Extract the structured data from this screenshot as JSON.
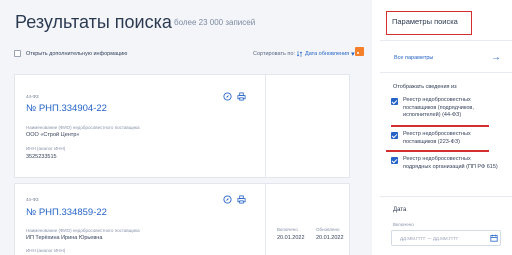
{
  "header": {
    "title": "Результаты поиска",
    "count": "более 23 000 записей"
  },
  "toolbar": {
    "more_info_label": "Открыть дополнительную информацию",
    "sort_label": "Сортировать по:",
    "sort_value": "Дата обновления"
  },
  "results": [
    {
      "law": "44-ФЗ",
      "number": "№ РНП.334904-22",
      "supplier_label": "Наименование (ФИО) недобросовестного поставщика",
      "supplier": "ООО «Строй Центр»",
      "inn_label": "ИНН (аналог ИНН)",
      "inn": "3525233515"
    },
    {
      "law": "44-ФЗ",
      "number": "№ РНП.334859-22",
      "supplier_label": "Наименование (ФИО) недобросовестного поставщика",
      "supplier": "ИП Терёхина Ирина Юрьевна",
      "inn_label": "ИНН (аналог ИНН)",
      "included_label": "Включено",
      "included_date": "20.01.2022",
      "updated_label": "Обновлено",
      "updated_date": "20.01.2022"
    }
  ],
  "panel": {
    "title": "Параметры поиска",
    "all_params": "Все параметры",
    "show_label": "Отображать сведения из",
    "registries": [
      {
        "text": "Реестр недобросовестных поставщиков (подрядчиков, исполнителей) (44-ФЗ)",
        "checked": true
      },
      {
        "text": "Реестр недобросовестных поставщиков (223-ФЗ)",
        "checked": true
      },
      {
        "text": "Реестр недобросовестных подрядных организаций (ПП РФ 615)",
        "checked": true
      }
    ],
    "date_label": "Дата",
    "included_label": "Включено",
    "date_placeholder": "ДД.ММ.ГГГГ — ДД.ММ.ГГГГ"
  },
  "colors": {
    "accent": "#2563c7",
    "highlight": "#d32f2f",
    "rss": "#f5802a"
  }
}
